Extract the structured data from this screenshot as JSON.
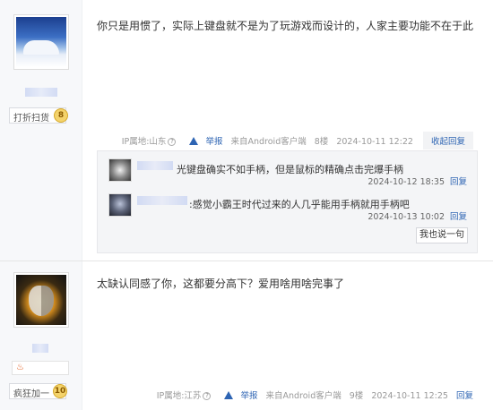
{
  "posts": [
    {
      "badge": "打折扫货",
      "level": "8",
      "content": "你只是用惯了，实际上键盘就不是为了玩游戏而设计的，人家主要功能不在于此",
      "ip": "IP属地:山东",
      "report": "举报",
      "client": "来自Android客户端",
      "floor": "8楼",
      "time": "2024-10-11 12:22",
      "reply_action": "收起回复",
      "sub_replies": [
        {
          "text": "光键盘确实不如手柄，但是鼠标的精确点击完爆手柄",
          "time": "2024-10-12 18:35",
          "reply": "回复"
        },
        {
          "text": ":感觉小霸王时代过来的人几乎能用手柄就用手柄吧",
          "time": "2024-10-13 10:02",
          "reply": "回复"
        }
      ],
      "say_button": "我也说一句"
    },
    {
      "badge": "疯狂加一",
      "level": "10",
      "content": "太缺认同感了你，这都要分高下？爱用啥用啥完事了",
      "ip": "IP属地:江苏",
      "report": "举报",
      "client": "来自Android客户端",
      "floor": "9楼",
      "time": "2024-10-11 12:25",
      "reply_action": "回复"
    }
  ],
  "icons": {
    "help": "question-circle-icon",
    "report": "warning-triangle-icon",
    "flame": "flame-icon"
  },
  "colors": {
    "link": "#2d64b3",
    "sidebar": "#f7f8fa"
  }
}
